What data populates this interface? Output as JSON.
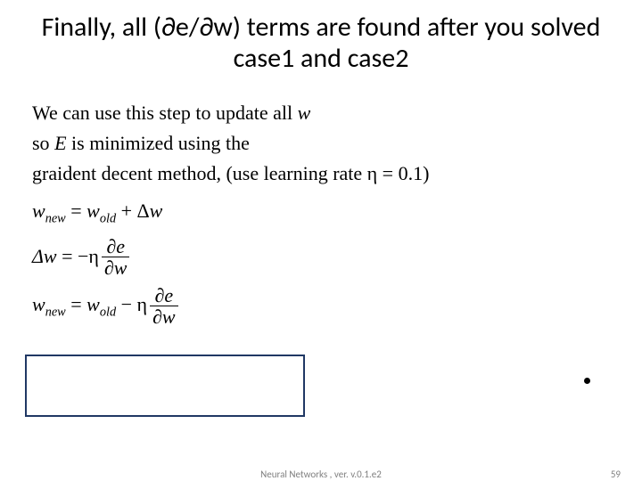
{
  "title": "Finally, all  (∂e/∂w) terms are found after you solved case1 and case2",
  "body": {
    "line1_a": "We can use this step to update all ",
    "line1_w": "w",
    "line2_a": "so ",
    "line2_E": "E",
    "line2_b": " is minimized using the",
    "line3_a": "graident decent method, (use learning rate η = ",
    "line3_val": "0.1",
    "line3_b": ")",
    "eq1_lhs_base": "w",
    "eq1_lhs_sub": "new",
    "eq1_eq": " = ",
    "eq1_rhs1_base": "w",
    "eq1_rhs1_sub": "old",
    "eq1_plus": " + Δ",
    "eq1_rhs2": "w",
    "eq2_lhs": "Δw",
    "eq2_eq": " = −η ",
    "eq3_lhs_base": "w",
    "eq3_lhs_sub": "new",
    "eq3_eq": " = ",
    "eq3_rhs_base": "w",
    "eq3_rhs_sub": "old",
    "eq3_min": " − η ",
    "frac_num": "∂e",
    "frac_den": "∂w"
  },
  "footer": {
    "center": "Neural Networks , ver. v.0.1.e2",
    "page": "59"
  }
}
